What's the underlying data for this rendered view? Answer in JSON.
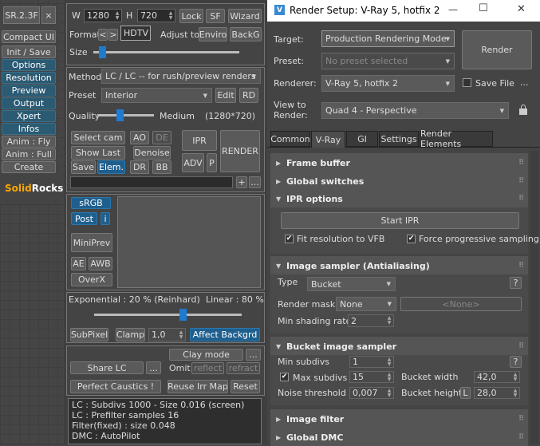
{
  "left_strip": {
    "title": "SR.2.3F",
    "close": "×",
    "buttons": [
      "Compact UI",
      "Init / Save",
      "Options",
      "Resolution",
      "Preview",
      "Output",
      "Xpert",
      "Infos",
      "Anim : Fly",
      "Anim : Full",
      "Create"
    ],
    "brand_a": "Solid",
    "brand_b": "Rocks"
  },
  "sr": {
    "w_label": "W",
    "w_value": "1280",
    "h_label": "H",
    "h_value": "720",
    "lock": "Lock",
    "sf": "SF",
    "wizard": "Wizard",
    "format_label": "Format",
    "prev": "<",
    "next": ">",
    "format_value": "HDTV",
    "adjust_label": "Adjust to",
    "enviro": "Enviro",
    "backg": "BackG",
    "size_label": "Size",
    "method_label": "Method",
    "method_value": "LC / LC -- for rush/preview renders",
    "preset_label": "Preset",
    "preset_value": "Interior",
    "edit": "Edit",
    "rd": "RD",
    "quality_label": "Quality",
    "quality_value": "Medium",
    "quality_res": "(1280*720)",
    "select_cam": "Select cam",
    "ao": "AO",
    "de": "DE",
    "ipr": "IPR",
    "render": "RENDER",
    "show_last": "Show Last",
    "denoise": "Denoise",
    "adv": "ADV",
    "p": "P",
    "save": "Save",
    "elem": "Elem.",
    "dr": "DR",
    "bb": "BB",
    "plus": "+",
    "dots": "...",
    "srgb": "sRGB",
    "post": "Post",
    "i": "i",
    "miniprev": "MiniPrev",
    "ae": "AE",
    "awb": "AWB",
    "overx": "OverX",
    "exponential": "Exponential : 20 %  (Reinhard)",
    "linear": "Linear : 80 %",
    "subpixel": "SubPixel",
    "clamp": "Clamp",
    "clamp_value": "1,0",
    "affect_backgrd": "Affect Backgrd",
    "clay_mode": "Clay mode",
    "share_lc": "Share LC",
    "omit_label": "Omit :",
    "reflect": "reflect",
    "refract": "refract",
    "perfect_caustics": "Perfect Caustics !",
    "reuse_irr": "Reuse Irr Map",
    "reset": "Reset",
    "info_lines": [
      "LC : Subdivs 1000 - Size 0.016 (screen)",
      "LC : Prefilter samples 16",
      "Filter(fixed) : size 0.048",
      "DMC : AutoPilot"
    ],
    "size_slider": 0.06,
    "quality_slider": 0.4,
    "exposure_slider": 0.6
  },
  "render_setup": {
    "title": "Render Setup: V-Ray 5, hotfix 2",
    "minimize": "—",
    "maximize": "☐",
    "close": "✕",
    "target_label": "Target:",
    "target_value": "Production Rendering Mode",
    "render_button": "Render",
    "preset_label": "Preset:",
    "preset_placeholder": "No preset selected",
    "renderer_label": "Renderer:",
    "renderer_value": "V-Ray 5, hotfix 2",
    "save_file": "Save File",
    "save_file_dots": "...",
    "view_label": "View to\nRender:",
    "view_value": "Quad 4 - Perspective",
    "tabs": [
      "Common",
      "V-Ray",
      "GI",
      "Settings",
      "Render Elements"
    ],
    "rollouts": {
      "frame_buffer": "Frame buffer",
      "global_switches": "Global switches",
      "ipr_options": "IPR options",
      "start_ipr": "Start IPR",
      "fit_resolution": "Fit resolution to VFB",
      "force_progressive": "Force progressive sampling",
      "image_sampler": "Image sampler (Antialiasing)",
      "type_label": "Type",
      "type_value": "Bucket",
      "q": "?",
      "render_mask_label": "Render mask",
      "render_mask_value": "None",
      "render_mask_object": "<None>",
      "min_shading_label": "Min shading rate",
      "min_shading_value": "2",
      "bucket_sampler": "Bucket image sampler",
      "min_subdivs_label": "Min subdivs",
      "min_subdivs_value": "1",
      "max_subdivs_label": "Max subdivs",
      "max_subdivs_value": "15",
      "bucket_width_label": "Bucket width",
      "bucket_width_value": "42,0",
      "noise_label": "Noise threshold",
      "noise_value": "0,007",
      "bucket_height_label": "Bucket height",
      "l": "L",
      "bucket_height_value": "28,0",
      "image_filter": "Image filter",
      "global_dmc": "Global DMC"
    }
  }
}
